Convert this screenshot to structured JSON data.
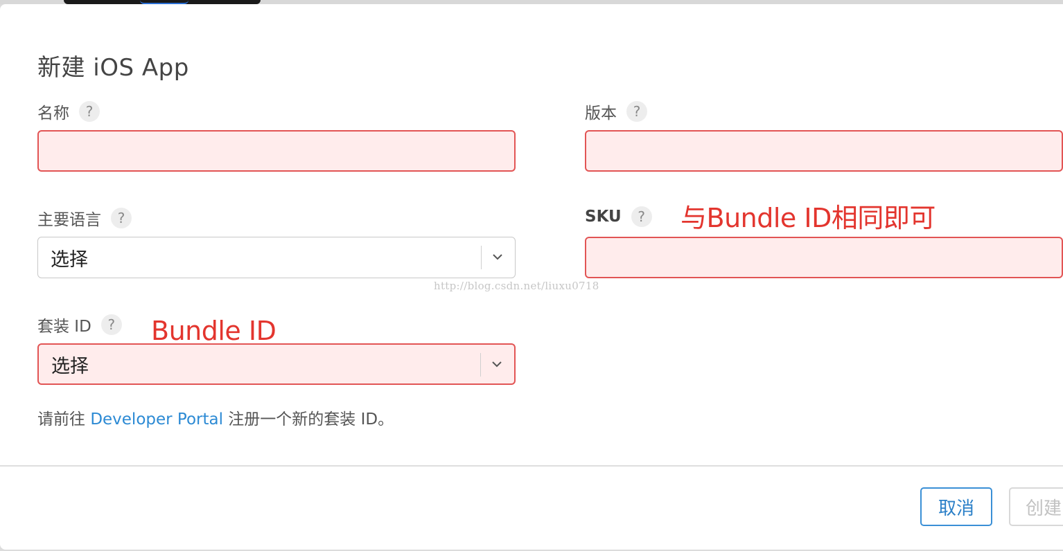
{
  "dialog": {
    "title": "新建 iOS App",
    "fields": {
      "name": {
        "label": "名称",
        "help": "?"
      },
      "version": {
        "label": "版本",
        "help": "?"
      },
      "primary_language": {
        "label": "主要语言",
        "help": "?",
        "selected": "选择"
      },
      "sku": {
        "label": "SKU",
        "help": "?"
      },
      "bundle_id": {
        "label": "套装 ID",
        "help": "?",
        "selected": "选择"
      }
    },
    "note": {
      "prefix": "请前往 ",
      "link": "Developer Portal",
      "suffix": " 注册一个新的套装 ID。"
    },
    "buttons": {
      "cancel": "取消",
      "create": "创建"
    }
  },
  "annotations": {
    "sku_hint": "与Bundle ID相同即可",
    "bundle_hint": "Bundle ID"
  },
  "watermark": "http://blog.csdn.net/liuxu0718",
  "colors": {
    "error_border": "#e25454",
    "error_fill": "#ffecec",
    "link": "#2c8ad4",
    "annotation": "#e3352e",
    "button_primary": "#3a8fd6"
  }
}
